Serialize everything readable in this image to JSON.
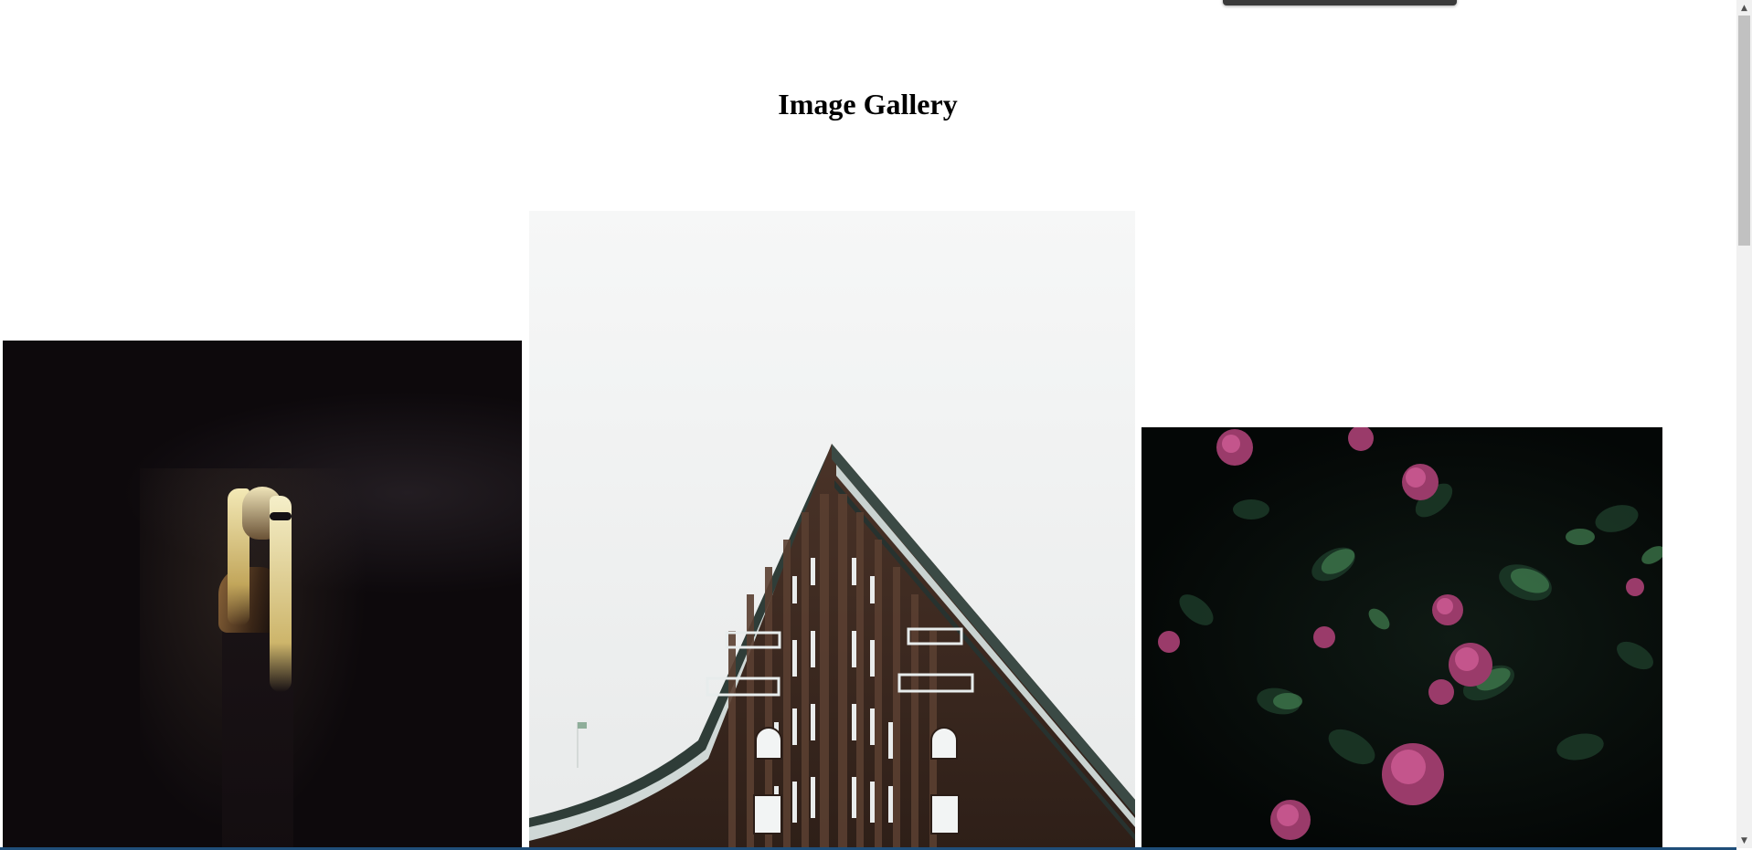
{
  "page": {
    "title": "Image Gallery"
  },
  "gallery": {
    "images": [
      {
        "subject": "woman with blonde hair in dark room"
      },
      {
        "subject": "brick building with pointed roof"
      },
      {
        "subject": "pink roses with dark foliage"
      }
    ]
  },
  "scrollbar": {
    "up_icon": "▲",
    "down_icon": "▼"
  },
  "colors": {
    "background": "#ffffff",
    "title": "#000000",
    "scrollbar_track": "#f1f1f1",
    "scrollbar_thumb": "#c1c1c1"
  }
}
